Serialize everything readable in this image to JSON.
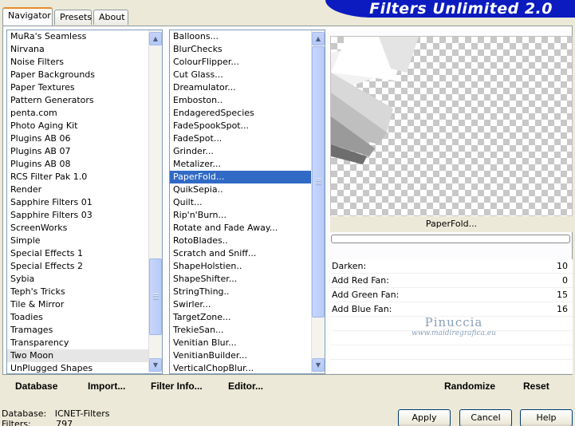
{
  "tabs": [
    "Navigator",
    "Presets",
    "About"
  ],
  "app_title": "Filters Unlimited 2.0",
  "categories": [
    "MuRa's Seamless",
    "Nirvana",
    "Noise Filters",
    "Paper Backgrounds",
    "Paper Textures",
    "Pattern Generators",
    "penta.com",
    "Photo Aging Kit",
    "Plugins AB 06",
    "Plugins AB 07",
    "Plugins AB 08",
    "RCS Filter Pak 1.0",
    "Render",
    "Sapphire Filters 01",
    "Sapphire Filters 03",
    "ScreenWorks",
    "Simple",
    "Special Effects 1",
    "Special Effects 2",
    "Sybia",
    "Teph's Tricks",
    "Tile & Mirror",
    "Toadies",
    "Tramages",
    "Transparency",
    "Two Moon",
    "UnPlugged Shapes"
  ],
  "categories_highlighted": "Two Moon",
  "filters": [
    "Balloons...",
    "BlurChecks",
    "ColourFlipper...",
    "Cut Glass...",
    "Dreamulator...",
    "Emboston..",
    "EndageredSpecies",
    "FadeSpookSpot...",
    "FadeSpot...",
    "Grinder...",
    "Metalizer...",
    "PaperFold...",
    "QuikSepia..",
    "Quilt...",
    "Rip'n'Burn...",
    "Rotate and Fade Away...",
    "RotoBlades..",
    "Scratch and Sniff...",
    "ShapeHolstien..",
    "ShapeShifter...",
    "StringThing..",
    "Swirler...",
    "TargetZone...",
    "TrekieSan...",
    "Venitian Blur...",
    "VenitianBuilder...",
    "VerticalChopBlur..."
  ],
  "filters_selected": "PaperFold...",
  "current_filter": "PaperFold...",
  "params": [
    {
      "label": "Darken:",
      "value": "10"
    },
    {
      "label": "Add Red Fan:",
      "value": "0"
    },
    {
      "label": "Add Green Fan:",
      "value": "15"
    },
    {
      "label": "Add Blue Fan:",
      "value": "16"
    }
  ],
  "watermark": {
    "line1": "Pinuccia",
    "line2": "www.maidiregrafica.eu"
  },
  "bottom_left": {
    "database": "Database",
    "import": "Import...",
    "filter_info": "Filter Info...",
    "editor": "Editor..."
  },
  "bottom_right": {
    "randomize": "Randomize",
    "reset": "Reset"
  },
  "status": {
    "database_label": "Database:",
    "database_value": "ICNET-Filters",
    "filters_label": "Filters:",
    "filters_value": "797"
  },
  "buttons": {
    "apply": "Apply",
    "cancel": "Cancel",
    "help": "Help"
  },
  "colors": {
    "header_blue": "#0b1bbf",
    "selection": "#316ac5",
    "dialog_bg": "#ece9d8"
  }
}
